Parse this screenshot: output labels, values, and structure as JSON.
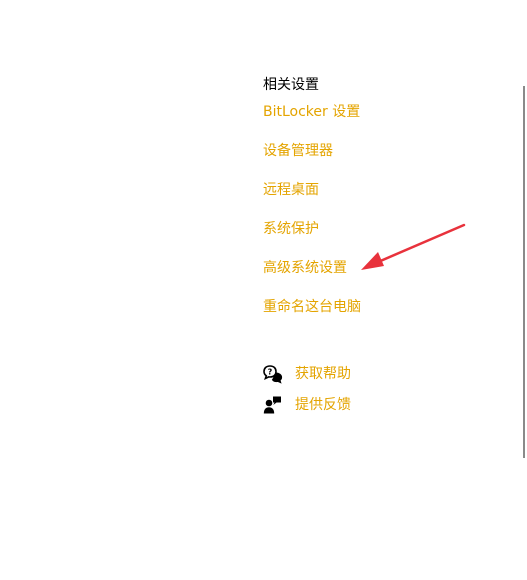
{
  "related_settings": {
    "title": "相关设置",
    "links": [
      {
        "label": "BitLocker 设置"
      },
      {
        "label": "设备管理器"
      },
      {
        "label": "远程桌面"
      },
      {
        "label": "系统保护"
      },
      {
        "label": "高级系统设置"
      },
      {
        "label": "重命名这台电脑"
      }
    ]
  },
  "help": {
    "get_help": {
      "label": "获取帮助",
      "icon": "chat-help-icon"
    },
    "feedback": {
      "label": "提供反馈",
      "icon": "feedback-person-icon"
    }
  },
  "colors": {
    "link": "#e4a400",
    "title": "#000000",
    "annotation_arrow": "#e8323c",
    "scrollbar": "#8a8a8a"
  }
}
